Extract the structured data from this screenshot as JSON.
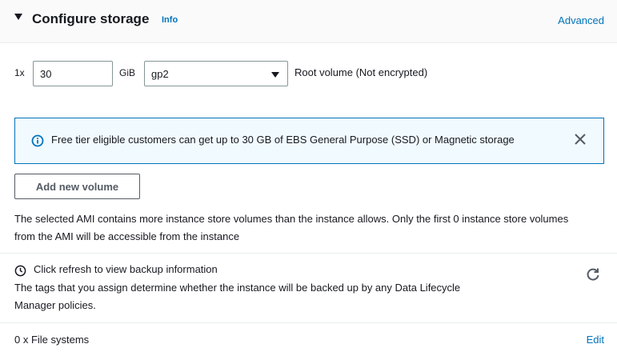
{
  "header": {
    "title": "Configure storage",
    "info_label": "Info",
    "advanced_label": "Advanced"
  },
  "volume_row": {
    "multiplier": "1x",
    "size_value": "30",
    "unit": "GiB",
    "volume_type": "gp2",
    "root_label": "Root volume  (Not encrypted)"
  },
  "alert": {
    "text": "Free tier eligible customers can get up to 30 GB of EBS General Purpose (SSD) or Magnetic storage"
  },
  "add_volume_label": "Add new volume",
  "ami_note": "The selected AMI contains more instance store volumes than the instance allows. Only the first 0 instance store volumes from the AMI will be accessible from the instance",
  "backup": {
    "title": "Click refresh to view backup information",
    "description": "The tags that you assign determine whether the instance will be backed up by any Data Lifecycle Manager policies."
  },
  "file_systems": {
    "label": "0 x File systems",
    "edit_label": "Edit"
  },
  "colors": {
    "link": "#0073bb",
    "alert_bg": "#f1faff",
    "alert_border": "#0073bb",
    "text": "#16191f"
  }
}
